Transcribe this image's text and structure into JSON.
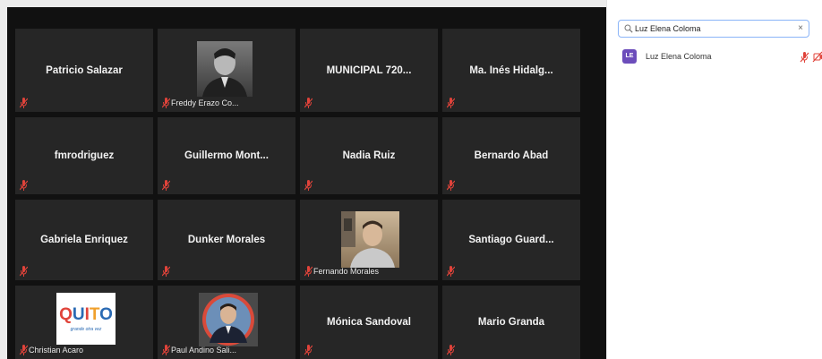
{
  "tiles": [
    {
      "name": "Patricio Salazar"
    },
    {
      "label": "Freddy Erazo Co..."
    },
    {
      "name": "MUNICIPAL  720..."
    },
    {
      "name": "Ma.  Inés  Hidalg..."
    },
    {
      "name": "fmrodriguez"
    },
    {
      "name": "Guillermo  Mont..."
    },
    {
      "name": "Nadia Ruiz"
    },
    {
      "name": "Bernardo Abad"
    },
    {
      "name": "Gabriela Enriquez"
    },
    {
      "name": "Dunker Morales"
    },
    {
      "label": "Fernando Morales"
    },
    {
      "name": "Santiago  Guard..."
    },
    {
      "label": "Christian Acaro",
      "logo_text": "QUITO",
      "logo_sub": "grande otra vez"
    },
    {
      "label": "Paul Andino Sali..."
    },
    {
      "name": "Mónica Sandoval"
    },
    {
      "name": "Mario Granda"
    }
  ],
  "participants_panel": {
    "search_value": "Luz Elena Coloma",
    "clear_icon": "×",
    "results": [
      {
        "initials": "LE",
        "name": "Luz Elena Coloma",
        "avatar_color": "#6c4dbb"
      }
    ]
  },
  "colors": {
    "tile_bg": "#262626",
    "mute_red": "#e0433a",
    "panel_border": "#8ab4f8"
  }
}
